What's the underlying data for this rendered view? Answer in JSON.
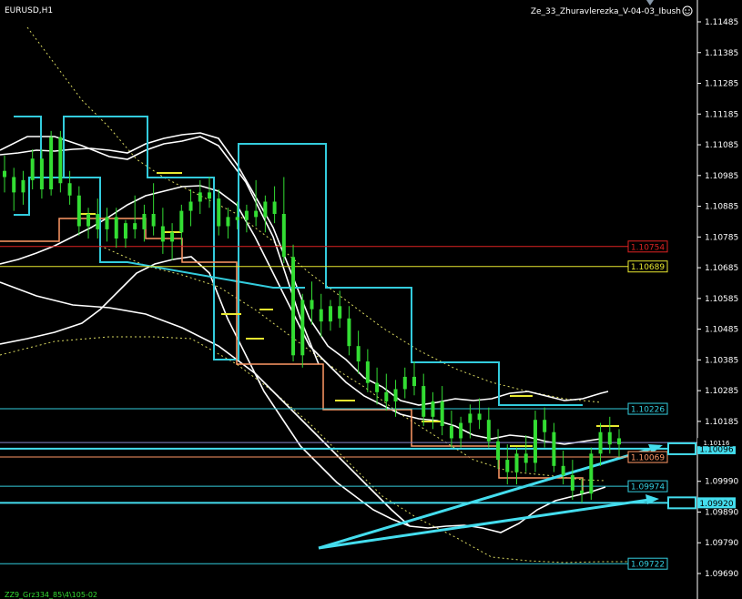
{
  "header": {
    "symbol_label": "EURUSD,H1",
    "indicator_label": "Ze_33_Zhuravlerezka_V-04-03_Ibush",
    "indicator_icon": "smiley-icon",
    "footer_label": "ZZ9_Grz334_85\\4\\105-02"
  },
  "colors": {
    "background": "#000000",
    "candles": "#33dd33",
    "bands": "#ffffff",
    "dashed": "#d8d860",
    "cyan": "#33ccdd",
    "orange": "#ff9966",
    "red": "#dd2222",
    "yellow": "#e8e830",
    "axis": "#ffffff",
    "arrow": "#44ddee"
  },
  "chart_data": {
    "type": "candlestick",
    "symbol": "EURUSD",
    "timeframe": "H1",
    "ylim": [
      1.0964,
      1.1154
    ],
    "y_ticks": [
      "1.11485",
      "1.11385",
      "1.11285",
      "1.11185",
      "1.11085",
      "1.10985",
      "1.10885",
      "1.10785",
      "1.10685",
      "1.10585",
      "1.10485",
      "1.10385",
      "1.10285",
      "1.10185",
      "1.09990",
      "1.09890",
      "1.09790",
      "1.09690"
    ],
    "price_lines": [
      {
        "label": "1.10754",
        "value": 1.10754,
        "color": "#dd2222",
        "style": "boxed"
      },
      {
        "label": "1.10689",
        "value": 1.10689,
        "color": "#e8e830",
        "style": "boxed"
      },
      {
        "label": "1.10226",
        "value": 1.10226,
        "color": "#33ccdd",
        "style": "boxed"
      },
      {
        "label": "1.10069",
        "value": 1.10069,
        "color": "#ff9966",
        "style": "boxed"
      },
      {
        "label": "1.09974",
        "value": 1.09974,
        "color": "#33ccdd",
        "style": "boxed"
      },
      {
        "label": "1.09722",
        "value": 1.09722,
        "color": "#33ccdd",
        "style": "boxed"
      },
      {
        "label": "1.10096",
        "value": 1.10096,
        "color": "#44ddee",
        "style": "highlight"
      },
      {
        "label": "1.09920",
        "value": 1.0992,
        "color": "#44ddee",
        "style": "highlight"
      }
    ],
    "current_price_label": "1.10116",
    "candles": [
      [
        1.11,
        1.1105,
        1.1093,
        1.1098
      ],
      [
        1.1098,
        1.1101,
        1.1087,
        1.1093
      ],
      [
        1.1093,
        1.11,
        1.1089,
        1.1097
      ],
      [
        1.1097,
        1.1107,
        1.1094,
        1.1104
      ],
      [
        1.1104,
        1.1107,
        1.1091,
        1.1094
      ],
      [
        1.1094,
        1.1113,
        1.1092,
        1.1111
      ],
      [
        1.1111,
        1.1113,
        1.1093,
        1.1096
      ],
      [
        1.1096,
        1.11,
        1.1089,
        1.1092
      ],
      [
        1.1092,
        1.1095,
        1.1079,
        1.1082
      ],
      [
        1.1082,
        1.1088,
        1.1078,
        1.1086
      ],
      [
        1.1086,
        1.1091,
        1.1078,
        1.1081
      ],
      [
        1.1081,
        1.1088,
        1.1077,
        1.1085
      ],
      [
        1.1085,
        1.1088,
        1.1075,
        1.1078
      ],
      [
        1.1078,
        1.1084,
        1.1075,
        1.1083
      ],
      [
        1.1083,
        1.1092,
        1.1078,
        1.1081
      ],
      [
        1.1081,
        1.1089,
        1.1077,
        1.1086
      ],
      [
        1.1086,
        1.1096,
        1.1079,
        1.1082
      ],
      [
        1.1082,
        1.1088,
        1.1073,
        1.1077
      ],
      [
        1.1077,
        1.1083,
        1.1071,
        1.108
      ],
      [
        1.108,
        1.1089,
        1.1076,
        1.1087
      ],
      [
        1.1087,
        1.1094,
        1.1082,
        1.109
      ],
      [
        1.109,
        1.1097,
        1.1086,
        1.1093
      ],
      [
        1.1093,
        1.1098,
        1.1088,
        1.1091
      ],
      [
        1.1091,
        1.1094,
        1.1079,
        1.1082
      ],
      [
        1.1082,
        1.1088,
        1.1078,
        1.1085
      ],
      [
        1.1085,
        1.109,
        1.1081,
        1.1084
      ],
      [
        1.1084,
        1.1089,
        1.108,
        1.1087
      ],
      [
        1.1087,
        1.1097,
        1.1082,
        1.1085
      ],
      [
        1.1085,
        1.1092,
        1.108,
        1.109
      ],
      [
        1.109,
        1.1095,
        1.1083,
        1.1086
      ],
      [
        1.1086,
        1.1098,
        1.107,
        1.1072
      ],
      [
        1.1072,
        1.1076,
        1.1038,
        1.104
      ],
      [
        1.104,
        1.106,
        1.1036,
        1.1058
      ],
      [
        1.1058,
        1.1064,
        1.105,
        1.1055
      ],
      [
        1.1055,
        1.106,
        1.1046,
        1.1051
      ],
      [
        1.1051,
        1.1058,
        1.1048,
        1.1056
      ],
      [
        1.1056,
        1.1061,
        1.1049,
        1.1052
      ],
      [
        1.1052,
        1.1056,
        1.104,
        1.1043
      ],
      [
        1.1043,
        1.1048,
        1.1034,
        1.1038
      ],
      [
        1.1038,
        1.1042,
        1.1028,
        1.1031
      ],
      [
        1.1031,
        1.1036,
        1.1024,
        1.1028
      ],
      [
        1.1028,
        1.1034,
        1.1022,
        1.1025
      ],
      [
        1.1025,
        1.1032,
        1.102,
        1.1029
      ],
      [
        1.1029,
        1.1036,
        1.1026,
        1.1033
      ],
      [
        1.1033,
        1.1038,
        1.1027,
        1.103
      ],
      [
        1.103,
        1.1034,
        1.1017,
        1.102
      ],
      [
        1.102,
        1.1028,
        1.1016,
        1.1025
      ],
      [
        1.1025,
        1.103,
        1.1014,
        1.1017
      ],
      [
        1.1017,
        1.1022,
        1.101,
        1.1013
      ],
      [
        1.1013,
        1.102,
        1.101,
        1.1018
      ],
      [
        1.1018,
        1.1024,
        1.1013,
        1.1021
      ],
      [
        1.1021,
        1.1026,
        1.1016,
        1.1019
      ],
      [
        1.1019,
        1.1023,
        1.101,
        1.1012
      ],
      [
        1.1012,
        1.1016,
        1.1003,
        1.1006
      ],
      [
        1.1006,
        1.1011,
        1.0998,
        1.1002
      ],
      [
        1.1002,
        1.101,
        1.0998,
        1.1008
      ],
      [
        1.1008,
        1.1014,
        1.1002,
        1.1005
      ],
      [
        1.1005,
        1.1022,
        1.1002,
        1.1019
      ],
      [
        1.1019,
        1.1023,
        1.101,
        1.1015
      ],
      [
        1.1015,
        1.1018,
        1.1002,
        1.1004
      ],
      [
        1.1004,
        1.1009,
        1.0998,
        1.1001
      ],
      [
        1.1001,
        1.1006,
        1.0993,
        1.0996
      ],
      [
        1.0996,
        1.1,
        1.0992,
        1.0995
      ],
      [
        1.0995,
        1.101,
        1.0993,
        1.1008
      ],
      [
        1.1008,
        1.1018,
        1.1004,
        1.1015
      ],
      [
        1.1015,
        1.102,
        1.1008,
        1.1011
      ],
      [
        1.1011,
        1.1016,
        1.1007,
        1.1013
      ]
    ],
    "grid": false
  }
}
